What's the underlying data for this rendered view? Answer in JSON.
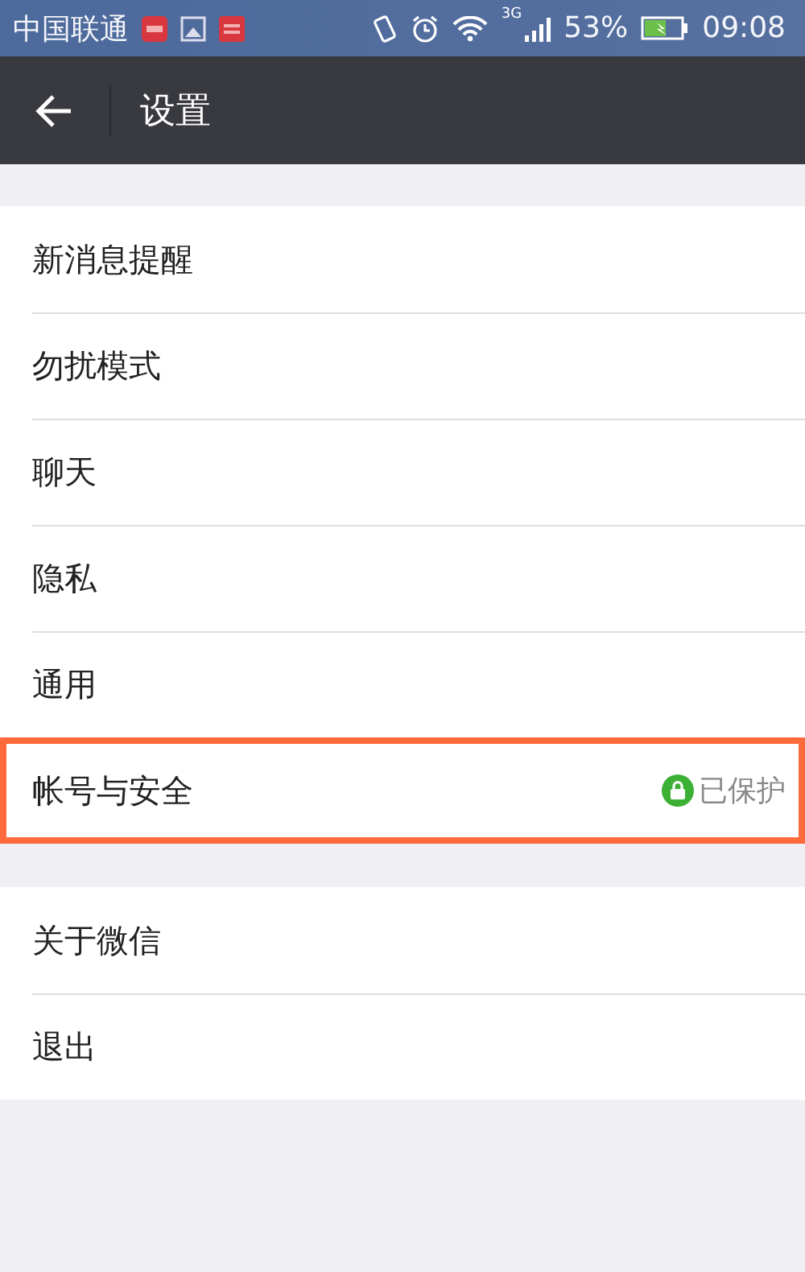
{
  "status_bar": {
    "carrier": "中国联通",
    "network": "3G",
    "battery": "53%",
    "time": "09:08"
  },
  "header": {
    "title": "设置"
  },
  "groups": [
    {
      "items": [
        {
          "label": "新消息提醒",
          "highlighted": false
        },
        {
          "label": "勿扰模式",
          "highlighted": false
        },
        {
          "label": "聊天",
          "highlighted": false
        },
        {
          "label": "隐私",
          "highlighted": false
        },
        {
          "label": "通用",
          "highlighted": false
        },
        {
          "label": "帐号与安全",
          "highlighted": true,
          "status": "已保护"
        }
      ]
    },
    {
      "items": [
        {
          "label": "关于微信",
          "highlighted": false
        },
        {
          "label": "退出",
          "highlighted": false
        }
      ]
    }
  ]
}
